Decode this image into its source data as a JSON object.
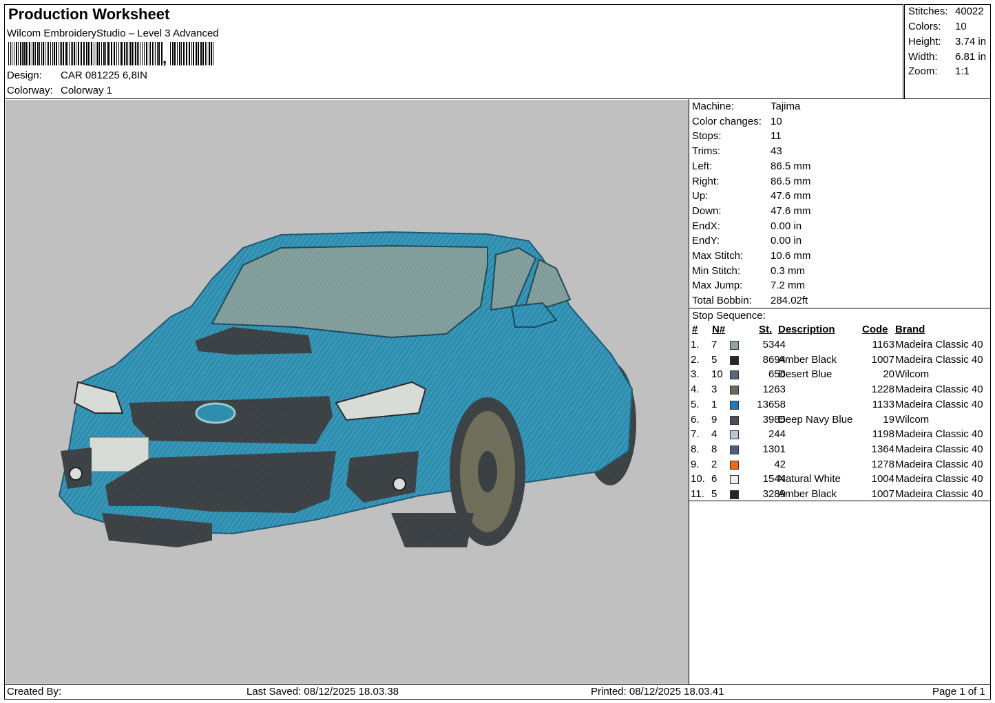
{
  "header": {
    "title": "Production Worksheet",
    "software": "Wilcom EmbroideryStudio – Level 3 Advanced",
    "barcode_trailer": ",",
    "design_label": "Design:",
    "design_value": "CAR 081225 6,8IN",
    "colorway_label": "Colorway:",
    "colorway_value": "Colorway 1"
  },
  "stats": [
    {
      "label": "Stitches:",
      "value": "40022"
    },
    {
      "label": "Colors:",
      "value": "10"
    },
    {
      "label": "Height:",
      "value": "3.74 in"
    },
    {
      "label": "Width:",
      "value": "6.81 in"
    },
    {
      "label": "Zoom:",
      "value": "1:1"
    }
  ],
  "machine_info": [
    {
      "label": "Machine:",
      "value": "Tajima"
    },
    {
      "label": "Color changes:",
      "value": "10"
    },
    {
      "label": "Stops:",
      "value": "11"
    },
    {
      "label": "Trims:",
      "value": "43"
    },
    {
      "label": "Left:",
      "value": "86.5 mm"
    },
    {
      "label": "Right:",
      "value": "86.5 mm"
    },
    {
      "label": "Up:",
      "value": "47.6 mm"
    },
    {
      "label": "Down:",
      "value": "47.6 mm"
    },
    {
      "label": "EndX:",
      "value": "0.00 in"
    },
    {
      "label": "EndY:",
      "value": "0.00 in"
    },
    {
      "label": "Max Stitch:",
      "value": "10.6 mm"
    },
    {
      "label": "Min Stitch:",
      "value": "0.3 mm"
    },
    {
      "label": "Max Jump:",
      "value": "7.2 mm"
    },
    {
      "label": "Total Bobbin:",
      "value": "284.02ft"
    }
  ],
  "stop_sequence": {
    "title": "Stop Sequence:",
    "columns": {
      "num": "#",
      "needle": "N#",
      "stitches": "St.",
      "description": "Description",
      "code": "Code",
      "brand": "Brand"
    },
    "rows": [
      {
        "num": "1.",
        "needle": "7",
        "color": "#8fa3a8",
        "stitches": "5344",
        "description": "",
        "code": "1163",
        "brand": "Madeira Classic 40"
      },
      {
        "num": "2.",
        "needle": "5",
        "color": "#262626",
        "stitches": "8694",
        "description": "Amber Black",
        "code": "1007",
        "brand": "Madeira Classic 40"
      },
      {
        "num": "3.",
        "needle": "10",
        "color": "#5a6577",
        "stitches": "656",
        "description": "Desert Blue",
        "code": "20",
        "brand": "Wilcom"
      },
      {
        "num": "4.",
        "needle": "3",
        "color": "#6e675d",
        "stitches": "1263",
        "description": "",
        "code": "1228",
        "brand": "Madeira Classic 40"
      },
      {
        "num": "5.",
        "needle": "1",
        "color": "#1f7bbd",
        "stitches": "13658",
        "description": "",
        "code": "1133",
        "brand": "Madeira Classic 40"
      },
      {
        "num": "6.",
        "needle": "9",
        "color": "#4a4d5e",
        "stitches": "3985",
        "description": "Deep Navy Blue",
        "code": "19",
        "brand": "Wilcom"
      },
      {
        "num": "7.",
        "needle": "4",
        "color": "#b8c8d8",
        "stitches": "244",
        "description": "",
        "code": "1198",
        "brand": "Madeira Classic 40"
      },
      {
        "num": "8.",
        "needle": "8",
        "color": "#4e5e78",
        "stitches": "1301",
        "description": "",
        "code": "1364",
        "brand": "Madeira Classic 40"
      },
      {
        "num": "9.",
        "needle": "2",
        "color": "#f06a10",
        "stitches": "42",
        "description": "",
        "code": "1278",
        "brand": "Madeira Classic 40"
      },
      {
        "num": "10.",
        "needle": "6",
        "color": "#eeeeee",
        "stitches": "1544",
        "description": "Natural White",
        "code": "1004",
        "brand": "Madeira Classic 40"
      },
      {
        "num": "11.",
        "needle": "5",
        "color": "#262626",
        "stitches": "3289",
        "description": "Amber Black",
        "code": "1007",
        "brand": "Madeira Classic 40"
      }
    ]
  },
  "footer": {
    "created_by": "Created By:",
    "last_saved": "Last Saved: 08/12/2025 18.03.38",
    "printed": "Printed: 08/12/2025 18.03.41",
    "page": "Page 1 of 1"
  }
}
